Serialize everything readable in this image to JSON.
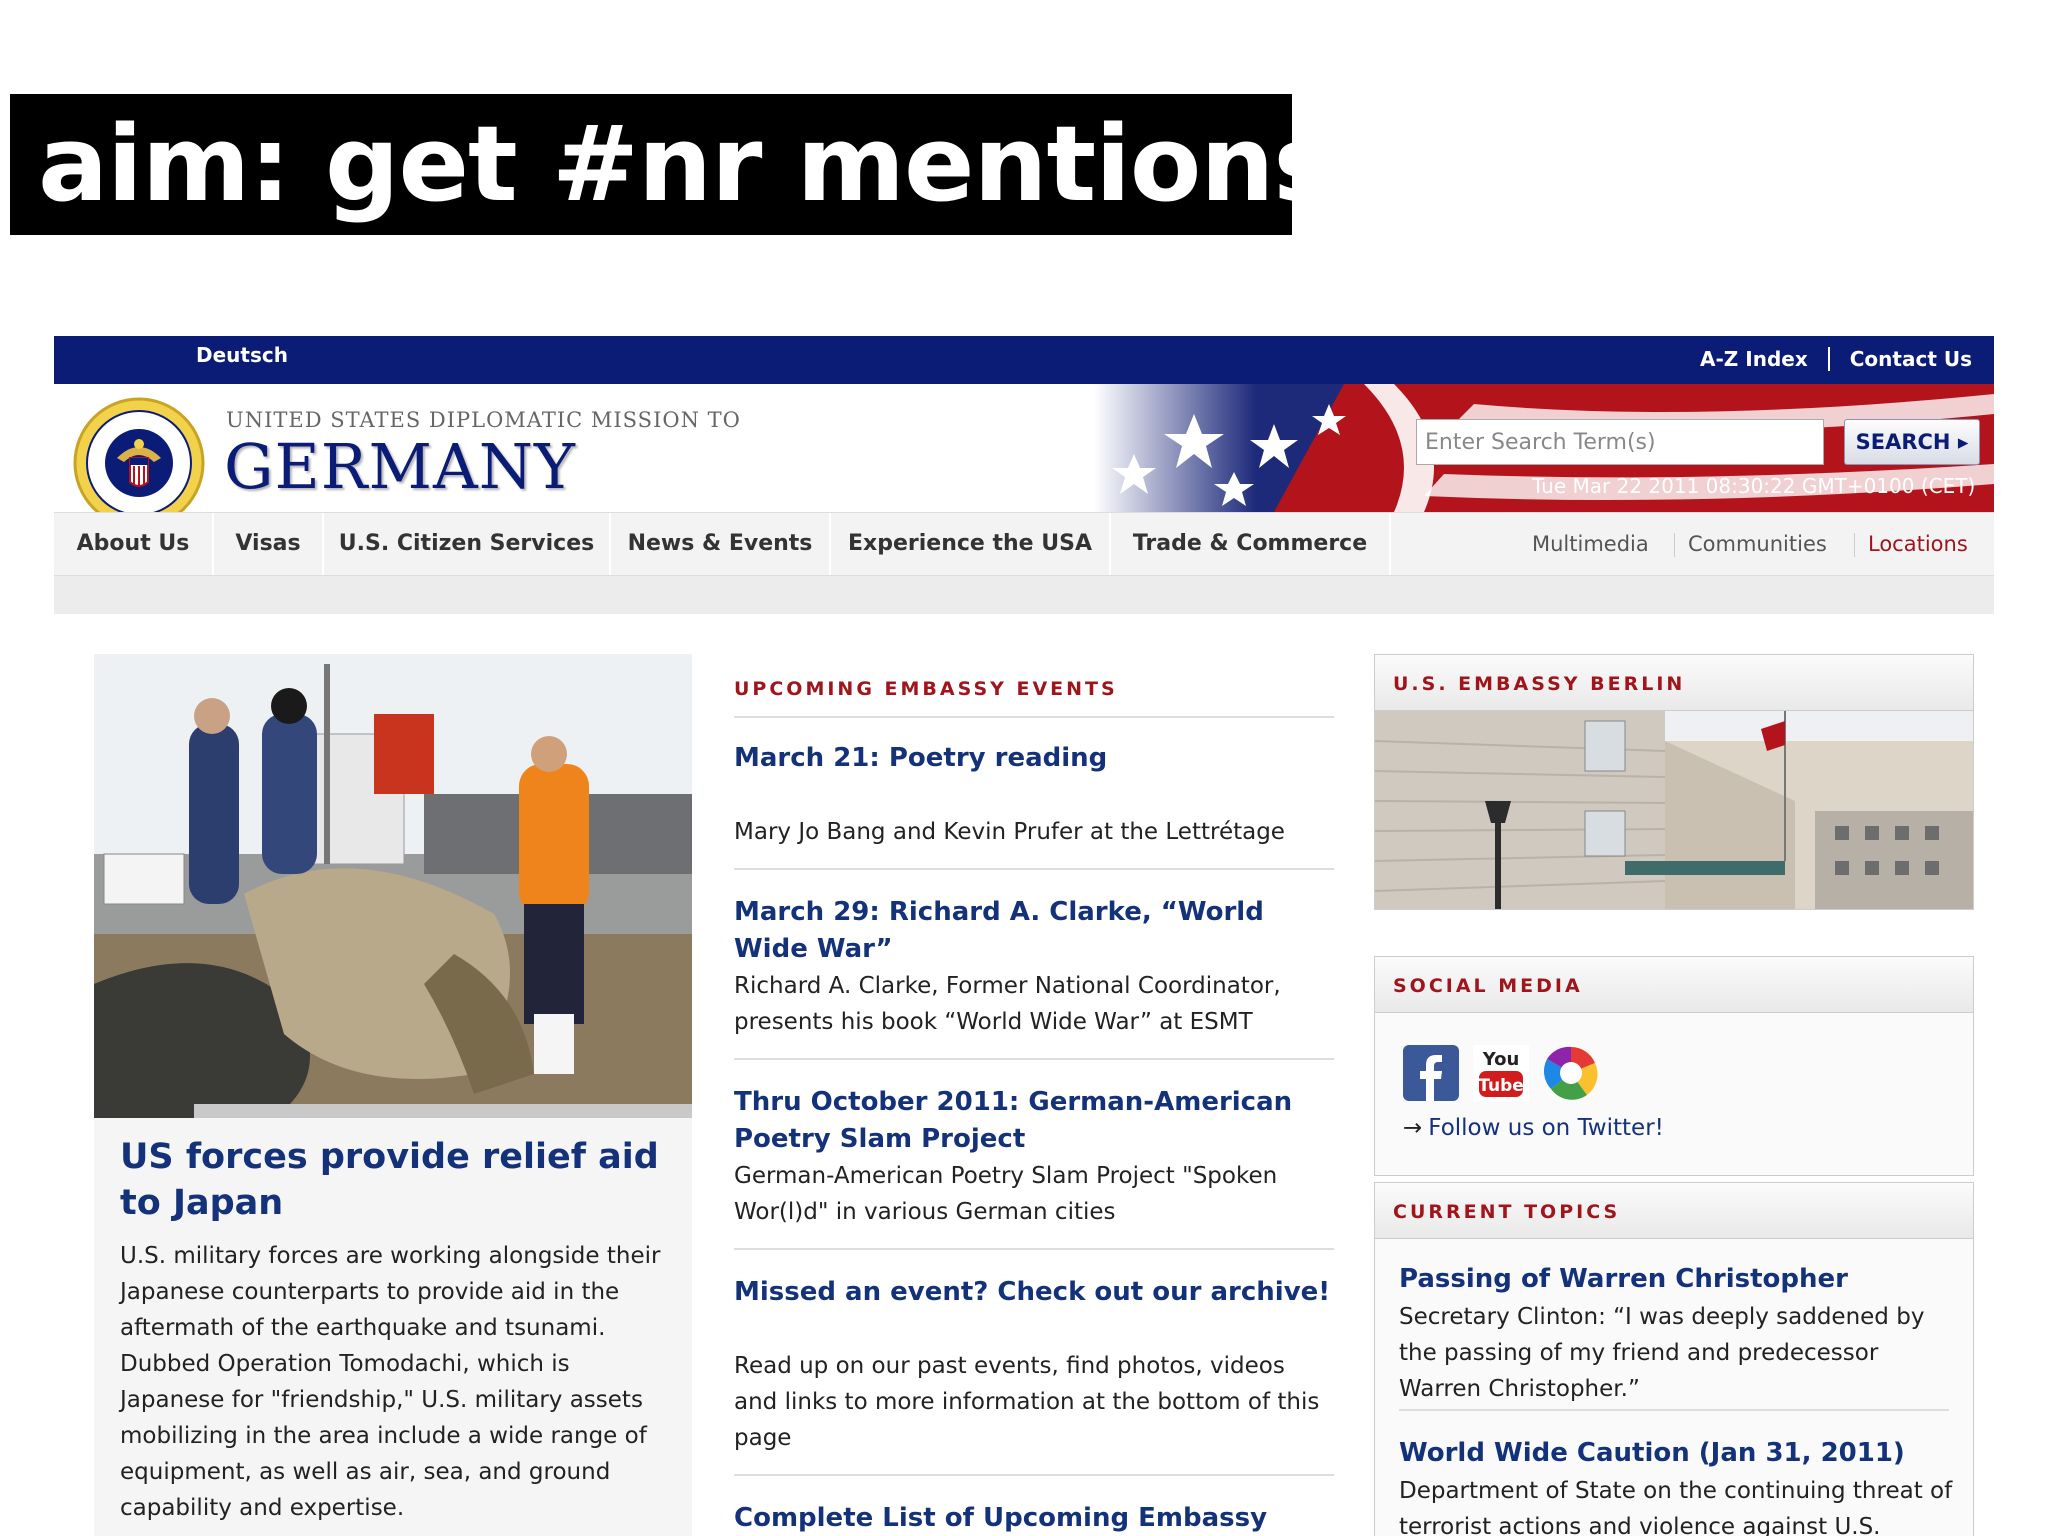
{
  "slide": {
    "title": "aim: get #nr mentions"
  },
  "topbar": {
    "language": "Deutsch",
    "az_index": "A-Z Index",
    "contact": "Contact Us"
  },
  "header": {
    "mission_line": "UNITED STATES DIPLOMATIC MISSION TO",
    "country": "GERMANY",
    "search_placeholder": "Enter Search Term(s)",
    "search_button": "SEARCH",
    "datetime": "Tue Mar 22 2011 08:30:22 GMT+0100 (CET)"
  },
  "nav": {
    "items": [
      "About Us",
      "Visas",
      "U.S. Citizen Services",
      "News & Events",
      "Experience the USA",
      "Trade & Commerce"
    ],
    "secondary": [
      "Multimedia",
      "Communities",
      "Locations"
    ]
  },
  "lead_story": {
    "title": "US forces provide relief aid to Japan",
    "body": "U.S. military forces are working alongside their Japanese counterparts to provide aid in the aftermath of the earthquake and tsunami. Dubbed Operation Tomodachi, which is Japanese for \"friendship,\" U.S. military assets mobilizing in the area include a wide range of equipment, as well as air, sea, and ground capability and expertise."
  },
  "events": {
    "heading": "UPCOMING EMBASSY EVENTS",
    "items": [
      {
        "title": "March 21: Poetry reading",
        "desc": "Mary Jo Bang and Kevin Prufer at the Lettrétage"
      },
      {
        "title": "March 29: Richard A. Clarke, “World Wide War”",
        "desc": "Richard A. Clarke, Former National Coordinator, presents his book “World Wide War” at ESMT"
      },
      {
        "title": "Thru October 2011: German-American Poetry Slam Project",
        "desc": "German-American Poetry Slam Project \"Spoken Wor(l)d\" in various German cities"
      },
      {
        "title": "Missed an event? Check out our archive!",
        "desc": "Read up on our past events, find photos, videos and links to more information at the bottom of this page"
      },
      {
        "title": "Complete List of Upcoming Embassy Events - Lectures, Exhibits",
        "desc": ""
      }
    ]
  },
  "sidebar": {
    "embassy_heading": "U.S. EMBASSY BERLIN",
    "social_heading": "SOCIAL MEDIA",
    "social_icons": [
      "facebook-icon",
      "youtube-icon",
      "picasa-icon"
    ],
    "youtube_you": "You",
    "youtube_tube": "Tube",
    "follow_arrow": "→",
    "follow_text": "Follow us on Twitter!",
    "topics_heading": "CURRENT TOPICS",
    "topics": [
      {
        "title": "Passing of Warren Christopher",
        "desc": "Secretary Clinton: “I was deeply saddened by the passing of my friend and predecessor Warren Christopher.”"
      },
      {
        "title": "World Wide Caution (Jan 31, 2011)",
        "desc": "Department of State on the continuing threat of terrorist actions and violence against U.S."
      }
    ]
  },
  "colors": {
    "navy": "#0b1c77",
    "link_blue": "#14327a",
    "section_red": "#a0151b",
    "flag_red": "#b3141c"
  }
}
